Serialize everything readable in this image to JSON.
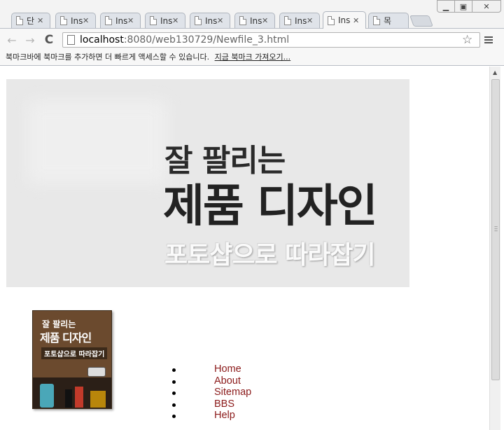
{
  "window": {
    "minimize_icon": "minimize-icon",
    "maximize_icon": "maximize-icon",
    "close_icon": "close-icon"
  },
  "tabs": [
    {
      "label": "단",
      "active": false
    },
    {
      "label": "Ins",
      "active": false
    },
    {
      "label": "Ins",
      "active": false
    },
    {
      "label": "Ins",
      "active": false
    },
    {
      "label": "Ins",
      "active": false
    },
    {
      "label": "Ins",
      "active": false
    },
    {
      "label": "Ins",
      "active": false
    },
    {
      "label": "Ins",
      "active": true
    },
    {
      "label": "목",
      "active": false
    }
  ],
  "toolbar": {
    "back_icon": "←",
    "forward_icon": "→",
    "reload_icon": "C",
    "url_host": "localhost",
    "url_path": ":8080/web130729/Newfile_3.html",
    "star_icon": "☆"
  },
  "bookmark_bar": {
    "message": "북마크바에 북마크를 추가하면 더 빠르게 액세스할 수 있습니다.",
    "link": "지금 북마크 가져오기..."
  },
  "banner": {
    "line1": "잘 팔리는",
    "line2": "제품 디자인",
    "line3": "포토샵으로 따라잡기"
  },
  "book_cover": {
    "line1": "잘 팔리는",
    "line2": "제품 디자인",
    "line3": "포토샵으로 따라잡기"
  },
  "nav_links": [
    {
      "label": "Home"
    },
    {
      "label": "About"
    },
    {
      "label": "Sitemap"
    },
    {
      "label": "BBS"
    },
    {
      "label": "Help"
    }
  ]
}
